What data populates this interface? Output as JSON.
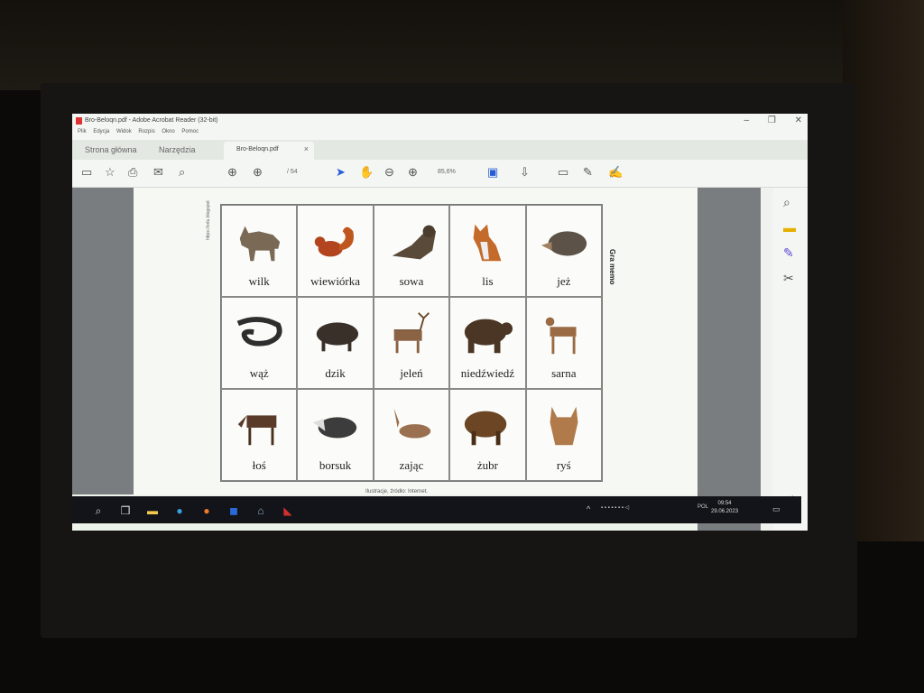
{
  "window": {
    "title": "Bro-Beloqn.pdf - Adobe Acrobat Reader (32-bit)",
    "menu": [
      "Plik",
      "Edycja",
      "Widok",
      "Rozpis",
      "Okno",
      "Pomoc"
    ]
  },
  "tabs": {
    "home": "Strona główna",
    "tools": "Narzędzia",
    "doc": "Bro-Beloqn.pdf",
    "doc_close": "×"
  },
  "toolbar": {
    "page_of": "/ 54",
    "zoom": "85,6%"
  },
  "document": {
    "side_note": "https://edu.blogspot",
    "right_title": "Gra memo",
    "footnote": "Ilustracje, źródło: Internet.",
    "animals": [
      "wilk",
      "wiewiórka",
      "sowa",
      "lis",
      "jeż",
      "wąż",
      "dzik",
      "jeleń",
      "niedźwiedź",
      "sarna",
      "łoś",
      "borsuk",
      "zając",
      "żubr",
      "ryś"
    ]
  },
  "taskbar": {
    "lang": "POL",
    "time": "09:54",
    "date": "29.06.2023"
  },
  "colors": {
    "acrobat_red": "#d32f2f",
    "taskbar": "#121419"
  }
}
